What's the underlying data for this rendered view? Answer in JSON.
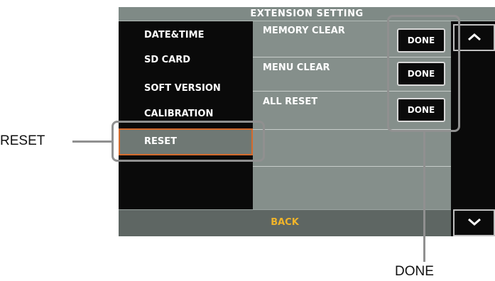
{
  "screen": {
    "title": "EXTENSION SETTING",
    "menu": [
      "DATE&TIME",
      "SD CARD",
      "SOFT VERSION",
      "CALIBRATION"
    ],
    "selected_menu": "RESET",
    "options": [
      {
        "label": "MEMORY CLEAR",
        "button": "DONE"
      },
      {
        "label": "MENU CLEAR",
        "button": "DONE"
      },
      {
        "label": "ALL RESET",
        "button": "DONE"
      }
    ],
    "bottom": {
      "back_label": "BACK"
    },
    "scroll_up_icon": "chevron-up-icon",
    "scroll_down_icon": "chevron-down-icon"
  },
  "annotations": {
    "reset_label": "RESET",
    "done_label": "DONE"
  },
  "colors": {
    "screen_bg": "#0a0a0a",
    "panel": "#858f8b",
    "selected_border": "#d46a2c",
    "back_text": "#f0b42a",
    "callout": "#909090"
  }
}
